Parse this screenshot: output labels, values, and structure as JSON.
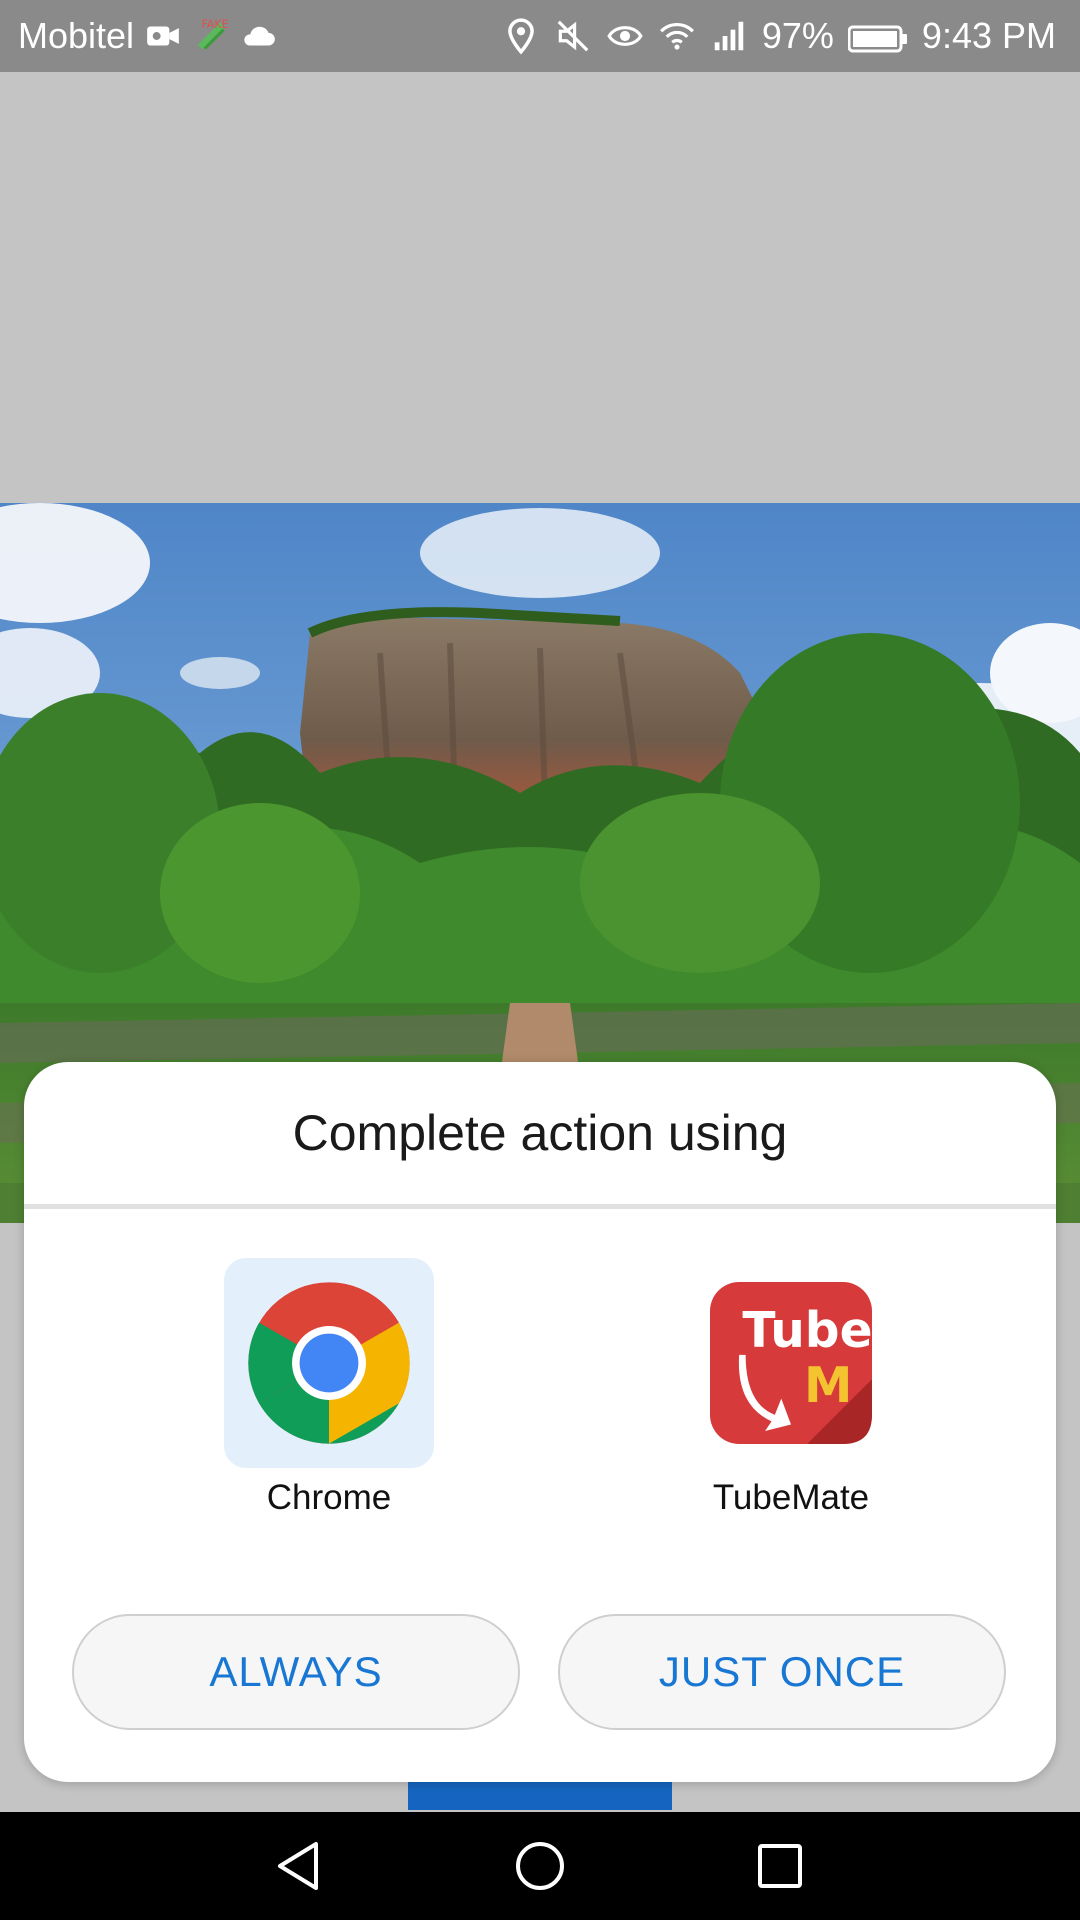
{
  "status_bar": {
    "carrier": "Mobitel",
    "battery": "97%",
    "time": "9:43 PM",
    "icons": [
      "video-camera-icon",
      "fake-gps-icon",
      "cloud-icon",
      "location-icon",
      "mute-icon",
      "eye-icon",
      "wifi-icon",
      "signal-icon",
      "battery-icon"
    ],
    "fake_label": "FAKE"
  },
  "dialog": {
    "title": "Complete action using",
    "apps": [
      {
        "name": "Chrome",
        "icon": "chrome-icon",
        "selected": true
      },
      {
        "name": "TubeMate",
        "icon": "tubemate-icon",
        "selected": false
      }
    ],
    "tubemate_logo_text": "Tube",
    "tubemate_logo_letter": "M",
    "buttons": {
      "always": "ALWAYS",
      "just_once": "JUST ONCE"
    }
  },
  "nav_bar": {
    "icons": [
      "back-icon",
      "home-icon",
      "recents-icon"
    ]
  },
  "colors": {
    "accent": "#1877d3",
    "status_bar": "#8a8a8a",
    "selected_tile": "#e3f0fc"
  }
}
